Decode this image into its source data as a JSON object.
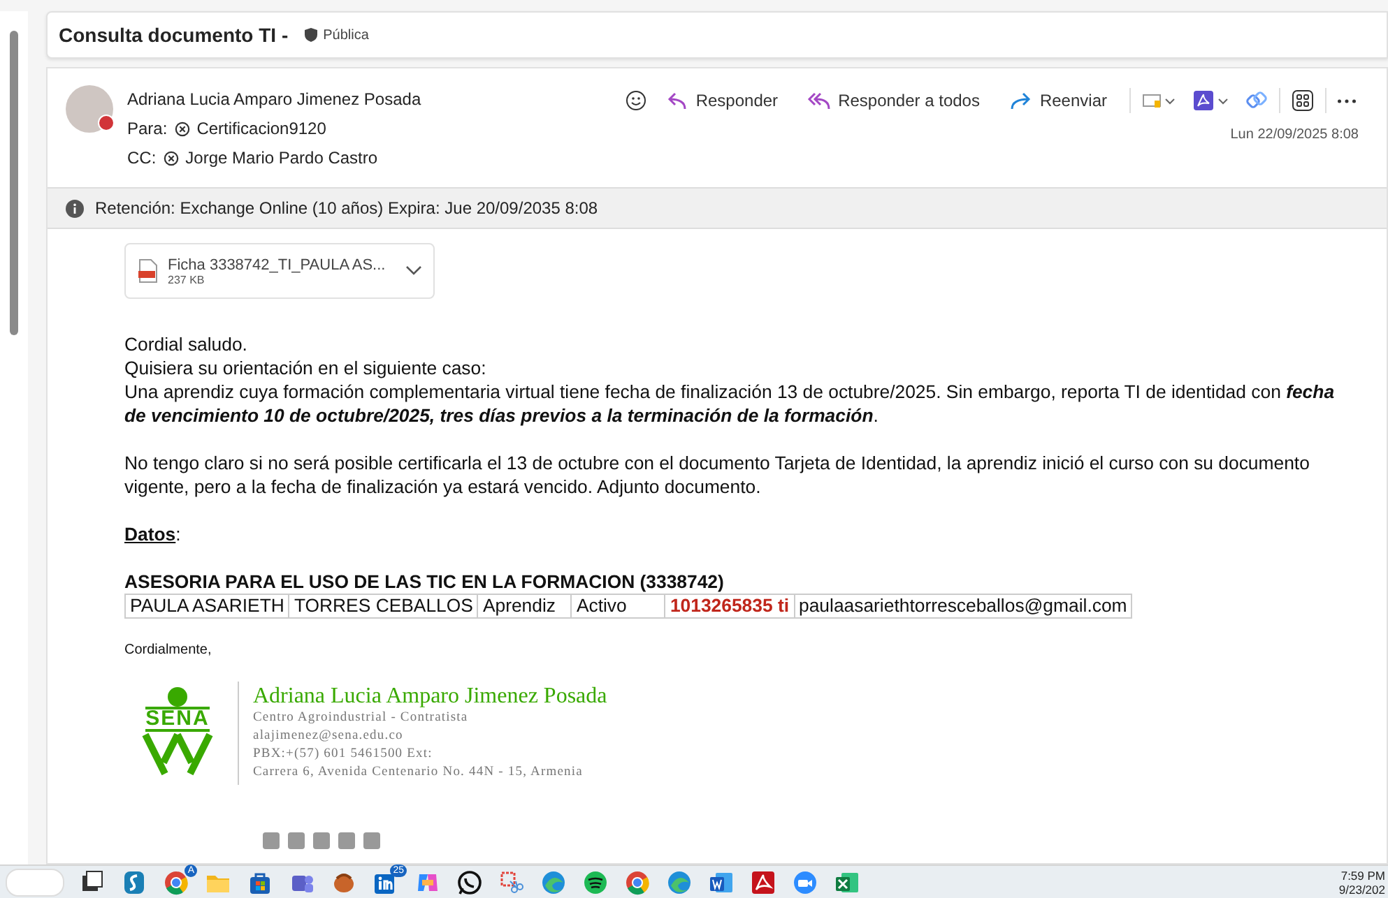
{
  "subject": {
    "title": "Consulta documento TI -",
    "label": "Pública"
  },
  "message": {
    "sender": "Adriana Lucia Amparo Jimenez Posada",
    "busy": true,
    "to_label": "Para:",
    "to": [
      "Certificacion9120"
    ],
    "cc_label": "CC:",
    "cc": [
      "Jorge Mario Pardo Castro"
    ],
    "actions": [
      {
        "kind": "reply",
        "label": "Responder"
      },
      {
        "kind": "reply_all",
        "label": "Responder a todos"
      },
      {
        "kind": "forward",
        "label": "Reenviar"
      }
    ],
    "date": "Lun 22/09/2025 8:08",
    "retention": "Retención: Exchange Online (10 años) Expira: Jue 20/09/2035 8:08",
    "attachment": {
      "name": "Ficha 3338742_TI_PAULA AS...",
      "size": "237 KB"
    },
    "body": [
      "Cordial saludo.",
      "Quisiera su orientación en el siguiente caso:",
      "Una aprendiz cuya formación complementaria virtual tiene fecha de finalización 13 de octubre/2025.  Sin embargo, reporta TI de identidad con **fecha de vencimiento 10 de octubre/2025, tres días previos a la terminación de la formación**."
    ],
    "body2": "No tengo claro si no será posible certificarla el 13 de octubre con el documento Tarjeta de Identidad, la aprendiz inició el curso con su documento vigente, pero a la fecha de finalización ya estará vencido. Adjunto documento.",
    "data_heading": "**Datos**:",
    "table_title": "ASESORIA PARA EL USO DE LAS TIC EN LA FORMACION (3338742)",
    "table_row": [
      {
        "text": "PAULA ASARIETH",
        "highlight": false
      },
      {
        "text": "TORRES CEBALLOS",
        "highlight": false
      },
      {
        "text": "Aprendiz",
        "highlight": false
      },
      {
        "text": "Activo",
        "highlight": false
      },
      {
        "text": "1013265835 ti",
        "highlight": true
      },
      {
        "text": "paulaasariethtorresceballos@gmail.com",
        "highlight": false
      }
    ],
    "closing": "Cordialmente,",
    "signature": {
      "logo_text": "SENA",
      "name": "Adriana Lucia Amparo Jimenez Posada",
      "lines": [
        "Centro Agroindustrial - Contratista",
        "alajimenez@sena.edu.co",
        "PBX:+(57) 601 5461500 Ext:",
        "Carrera 6, Avenida Centenario No. 44N - 15, Armenia"
      ]
    }
  },
  "taskbar": {
    "apps": [
      {
        "kind": "taskview"
      },
      {
        "kind": "s_app"
      },
      {
        "kind": "chrome",
        "badge": "A"
      },
      {
        "kind": "folder"
      },
      {
        "kind": "store"
      },
      {
        "kind": "teams"
      },
      {
        "kind": "glove"
      },
      {
        "kind": "linkedin",
        "badge": "25"
      },
      {
        "kind": "copilot"
      },
      {
        "kind": "whatsapp"
      },
      {
        "kind": "snip"
      },
      {
        "kind": "edge"
      },
      {
        "kind": "spotify"
      },
      {
        "kind": "chrome"
      },
      {
        "kind": "edge"
      },
      {
        "kind": "word"
      },
      {
        "kind": "acrobat"
      },
      {
        "kind": "zoom"
      },
      {
        "kind": "excel"
      }
    ],
    "time": "7:59 PM",
    "date": "9/23/202"
  }
}
